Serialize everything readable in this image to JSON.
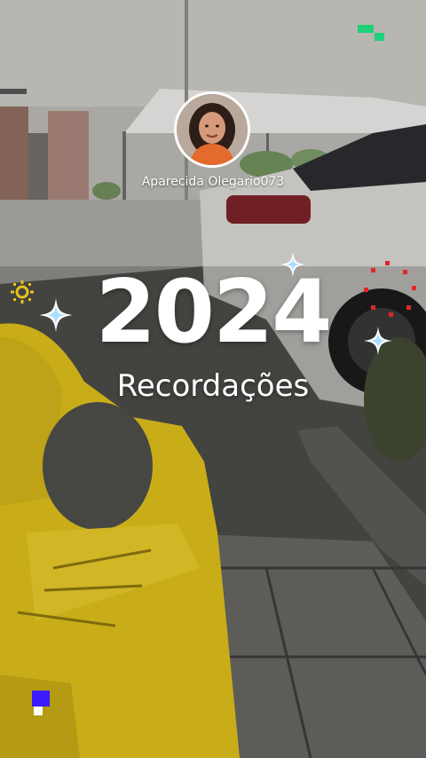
{
  "story": {
    "username": "Aparecida Olegario073",
    "title_year": "2024",
    "subtitle": "Recordações"
  },
  "icons": {
    "avatar": "profile-photo",
    "sparkles": [
      "sparkle-icon",
      "sparkle-icon",
      "sparkle-icon"
    ],
    "sun": "sun-icon",
    "dots": "red-dots-ring-icon",
    "corner_top": "green-pixel-blocks-icon",
    "corner_bottom": "blue-white-pixel-blocks-icon"
  },
  "colors": {
    "text": "#ffffff",
    "accent_green": "#1fd07a",
    "accent_blue": "#3a1cff",
    "chair_yellow": "#e0c21e",
    "sun_yellow": "#e8c21c",
    "dots_red": "#e0262b",
    "sparkle_blue": "#a9ddff"
  }
}
